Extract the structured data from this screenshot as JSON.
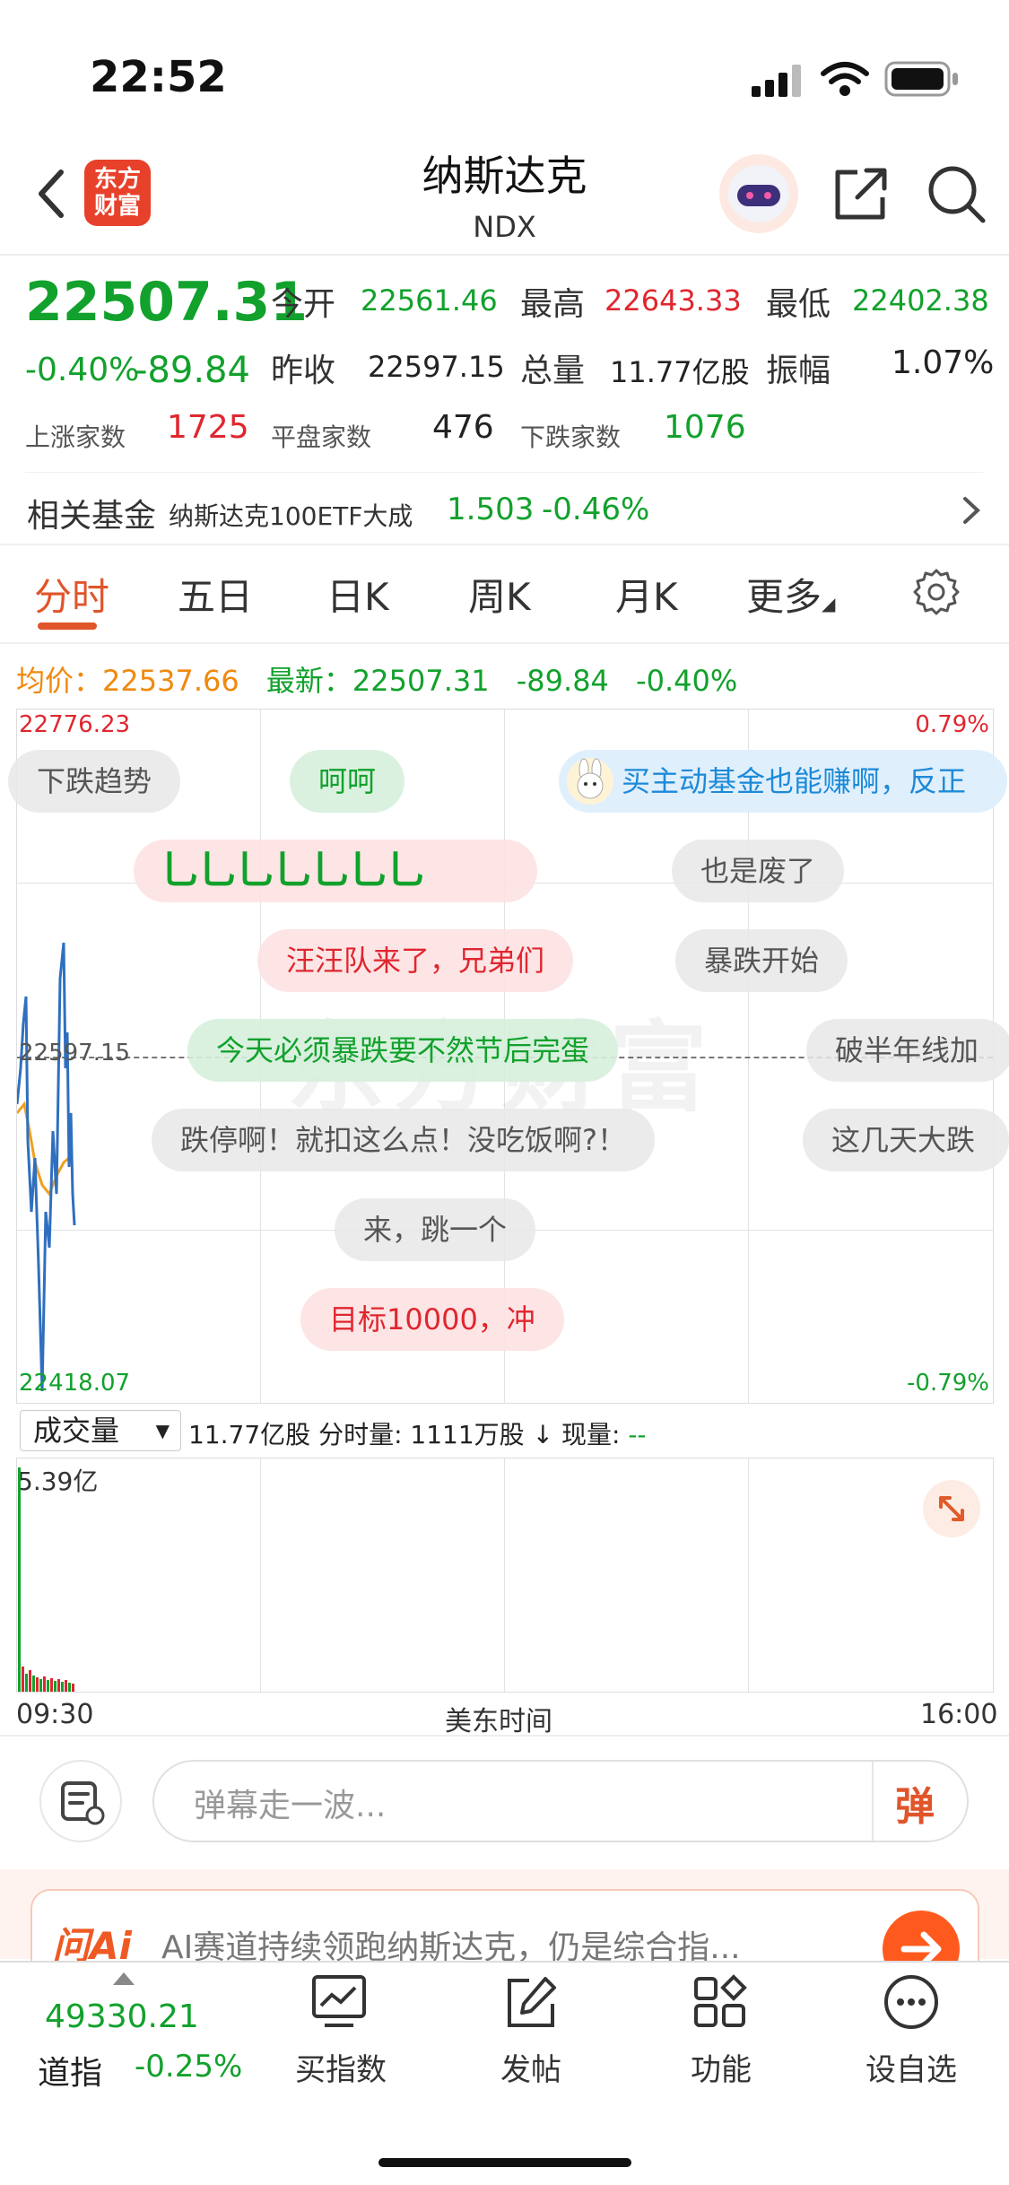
{
  "status_bar": {
    "time": "22:52"
  },
  "header": {
    "logo_text_line1": "东方",
    "logo_text_line2": "财富",
    "title": "纳斯达克",
    "code": "NDX"
  },
  "quote": {
    "price": "22507.31",
    "change_pct": "-0.40%",
    "change": "-89.84",
    "open_label": "今开",
    "open": "22561.46",
    "high_label": "最高",
    "high": "22643.33",
    "low_label": "最低",
    "low": "22402.38",
    "prev_close_label": "昨收",
    "prev_close": "22597.15",
    "volume_label": "总量",
    "volume": "11.77亿股",
    "amplitude_label": "振幅",
    "amplitude": "1.07%",
    "up_count_label": "上涨家数",
    "up_count": "1725",
    "flat_count_label": "平盘家数",
    "flat_count": "476",
    "down_count_label": "下跌家数",
    "down_count": "1076"
  },
  "related_fund": {
    "label": "相关基金",
    "name": "纳斯达克100ETF大成",
    "price": "1.503",
    "change_pct": "-0.46%"
  },
  "tabs": [
    {
      "label": "分时",
      "active": true
    },
    {
      "label": "五日"
    },
    {
      "label": "日K"
    },
    {
      "label": "周K"
    },
    {
      "label": "月K"
    },
    {
      "label": "更多"
    }
  ],
  "summary": {
    "avg_label": "均价：",
    "avg": "22537.66",
    "latest_label": "最新：",
    "latest": "22507.31",
    "change": "-89.84",
    "change_pct": "-0.40%"
  },
  "chart": {
    "y_top": "22776.23",
    "y_mid": "22597.15",
    "y_bottom": "22418.07",
    "pct_top": "0.79%",
    "pct_bottom": "-0.79%",
    "watermark": "东方财富",
    "colors": {
      "price_line": "#2f6fbf",
      "avg_line": "#f0a020",
      "up": "#e0262f",
      "down": "#12a12c"
    }
  },
  "danmaku": [
    {
      "text": "下跌趋势",
      "style": "gray"
    },
    {
      "text": "呵呵",
      "style": "green"
    },
    {
      "text": "买主动基金也能赚啊，反正",
      "style": "blue"
    },
    {
      "text": "乚乚乚乚乚乚乚",
      "style": "red"
    },
    {
      "text": "也是废了",
      "style": "gray"
    },
    {
      "text": "汪汪队来了，兄弟们",
      "style": "red"
    },
    {
      "text": "暴跌开始",
      "style": "gray"
    },
    {
      "text": "今天必须暴跌要不然节后完蛋",
      "style": "green"
    },
    {
      "text": "破半年线加",
      "style": "gray"
    },
    {
      "text": "跌停啊！就扣这么点！没吃饭啊?！",
      "style": "gray"
    },
    {
      "text": "这几天大跌",
      "style": "gray"
    },
    {
      "text": "来，跳一个",
      "style": "gray"
    },
    {
      "text": "目标10000，冲",
      "style": "red"
    }
  ],
  "volume_bar": {
    "selector": "成交量",
    "total": "11.77亿股",
    "minute_label": "分时量:",
    "minute": "1111万股",
    "current_label": "现量:",
    "current": "--",
    "max_label": "5.39亿"
  },
  "time_axis": {
    "start": "09:30",
    "middle": "美东时间",
    "end": "16:00"
  },
  "comment_bar": {
    "placeholder": "弹幕走一波...",
    "danmaku_button": "弹"
  },
  "ai_banner": {
    "brand": "问Ai",
    "text": "AI赛道持续领跑纳斯达克，仍是综合指..."
  },
  "bottom_nav": {
    "dow_value": "49330.21",
    "dow_label": "道指",
    "dow_change": "-0.25%",
    "items": [
      {
        "label": "买指数"
      },
      {
        "label": "发帖"
      },
      {
        "label": "功能"
      },
      {
        "label": "设自选"
      }
    ]
  }
}
